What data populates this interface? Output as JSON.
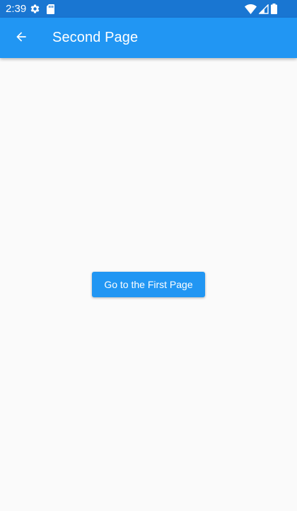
{
  "status_bar": {
    "time": "2:39",
    "left_icons": [
      "settings-icon",
      "sd-card-icon"
    ],
    "right_icons": [
      "wifi-icon",
      "signal-icon",
      "battery-icon"
    ],
    "background_color": "#1976d2"
  },
  "app_bar": {
    "back_icon": "arrow-back-icon",
    "title": "Second Page",
    "background_color": "#2196f3"
  },
  "main": {
    "button_label": "Go to the First Page",
    "button_color": "#2196f3",
    "background_color": "#fafafa"
  }
}
